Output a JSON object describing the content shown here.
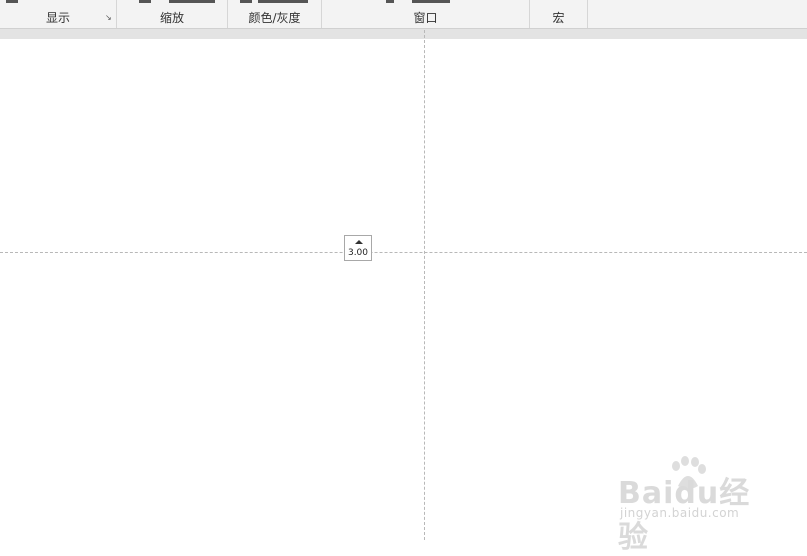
{
  "ribbon": {
    "groups": [
      {
        "label": "显示",
        "has_launcher": true,
        "launcher_icon": "dialog-launcher-icon"
      },
      {
        "label": "缩放"
      },
      {
        "label": "颜色/灰度"
      },
      {
        "label": "窗口"
      },
      {
        "label": "宏"
      }
    ],
    "launcher_glyph": "↘"
  },
  "canvas": {
    "spin_value": "3.00",
    "spin_icon": "up-arrow-icon"
  },
  "watermark": {
    "logo": "Baidu经验",
    "url": "jingyan.baidu.com"
  },
  "colors": {
    "ribbon_bg": "#f3f3f3",
    "guide": "#b8b8b8",
    "watermark": "#d6d6d6"
  }
}
